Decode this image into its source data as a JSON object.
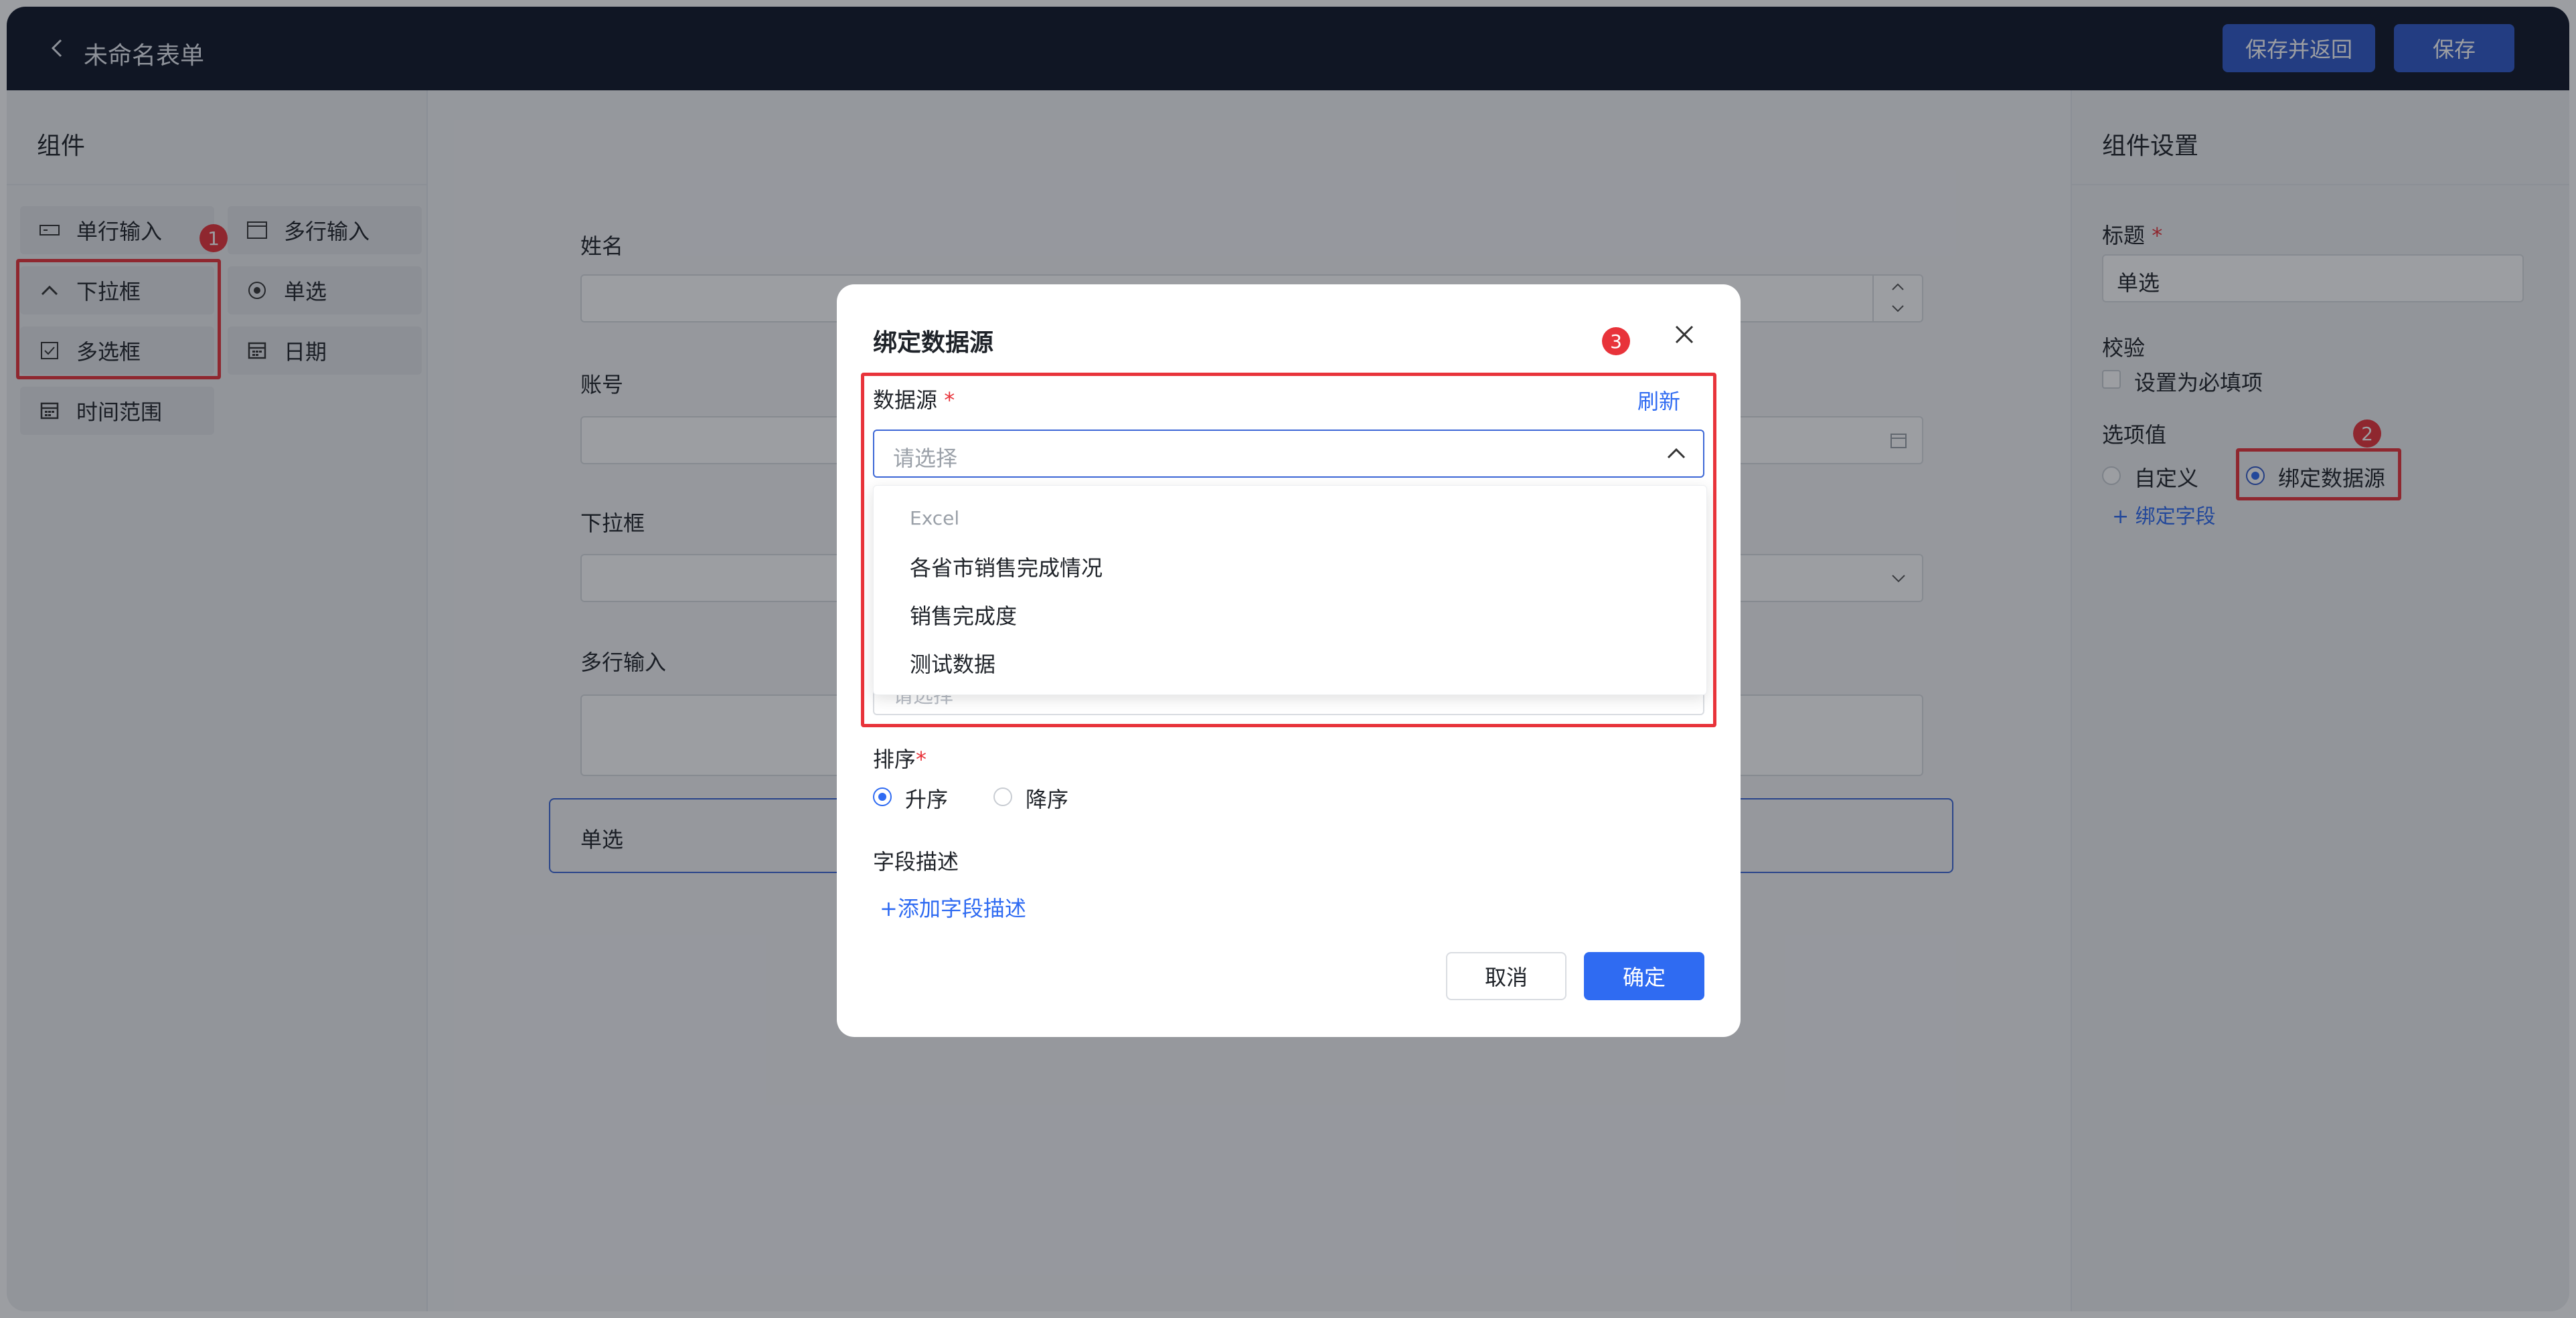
{
  "header": {
    "title": "未命名表单",
    "save_return_label": "保存并返回",
    "save_label": "保存"
  },
  "left_panel": {
    "title": "组件",
    "components": [
      {
        "label": "单行输入",
        "icon": "single-line-input-icon"
      },
      {
        "label": "多行输入",
        "icon": "multi-line-input-icon"
      },
      {
        "label": "下拉框",
        "icon": "chevron-up-icon"
      },
      {
        "label": "单选",
        "icon": "radio-icon"
      },
      {
        "label": "多选框",
        "icon": "checkbox-icon"
      },
      {
        "label": "日期",
        "icon": "calendar-icon"
      },
      {
        "label": "时间范围",
        "icon": "calendar-range-icon"
      }
    ]
  },
  "canvas": {
    "fields": [
      {
        "label": "姓名"
      },
      {
        "label": "账号"
      },
      {
        "label": "下拉框"
      },
      {
        "label": "多行输入"
      },
      {
        "label": "单选"
      }
    ]
  },
  "right_panel": {
    "title": "组件设置",
    "title_label": "标题",
    "title_value": "单选",
    "validation_label": "校验",
    "required_label": "设置为必填项",
    "options_label": "选项值",
    "custom_label": "自定义",
    "bind_source_label": "绑定数据源",
    "bind_field_link": "+ 绑定字段"
  },
  "annotations": {
    "badge1": "1",
    "badge2": "2",
    "badge3": "3"
  },
  "modal": {
    "title": "绑定数据源",
    "source_label": "数据源",
    "refresh": "刷新",
    "select_placeholder": "请选择",
    "dropdown_group": "Excel",
    "dropdown_items": [
      "各省市销售完成情况",
      "销售完成度",
      "测试数据"
    ],
    "sort_label": "排序",
    "sort_asc": "升序",
    "sort_desc": "降序",
    "field_desc_label": "字段描述",
    "add_field_desc": "+添加字段描述",
    "cancel": "取消",
    "confirm": "确定"
  },
  "colors": {
    "header_bg": "#0f1626",
    "primary": "#2f6bf2",
    "annotation_red": "#e8333a"
  }
}
